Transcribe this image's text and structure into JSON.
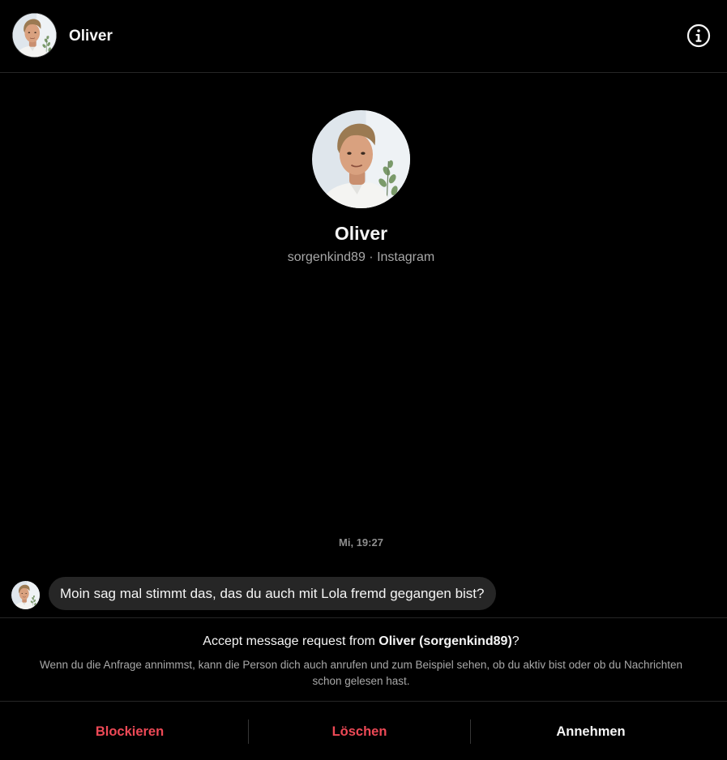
{
  "header": {
    "name": "Oliver",
    "info_icon": "info-circle-icon"
  },
  "profile": {
    "name": "Oliver",
    "subtitle": "sorgenkind89 · Instagram"
  },
  "conversation": {
    "timestamp": "Mi, 19:27",
    "messages": [
      {
        "sender": "Oliver",
        "text": "Moin sag mal stimmt das, das du auch mit Lola fremd gegangen bist?"
      }
    ]
  },
  "request": {
    "title_prefix": "Accept message request from ",
    "title_name": "Oliver (sorgenkind89)",
    "title_suffix": "?",
    "description": "Wenn du die Anfrage annimmst, kann die Person dich auch anrufen und zum Beispiel sehen, ob du aktiv bist oder ob du Nachrichten schon gelesen hast."
  },
  "actions": {
    "block_label": "Blockieren",
    "delete_label": "Löschen",
    "accept_label": "Annehmen"
  },
  "colors": {
    "background": "#000000",
    "text": "#f5f5f5",
    "muted": "#a8a8a8",
    "danger": "#ed4956",
    "bubble": "#262626",
    "border": "#262626"
  }
}
